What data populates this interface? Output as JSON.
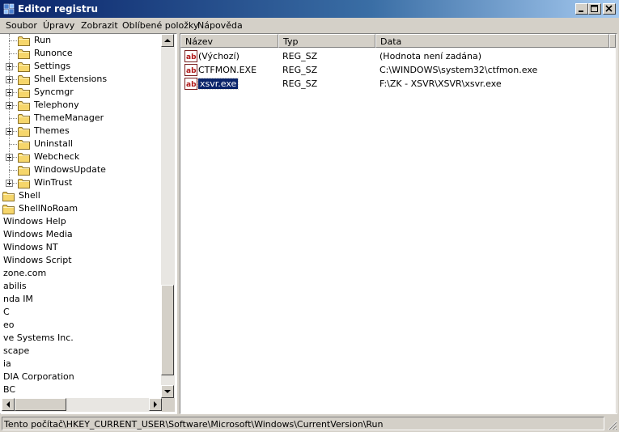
{
  "window": {
    "title": "Editor registru",
    "icon": "regedit-icon"
  },
  "menu": [
    {
      "label": "Soubor"
    },
    {
      "label": "Úpravy"
    },
    {
      "label": "Zobrazit"
    },
    {
      "label": "Oblíbené položky"
    },
    {
      "label": "Nápověda"
    }
  ],
  "tree": {
    "items": [
      {
        "label": "Run",
        "expandable": false
      },
      {
        "label": "Runonce",
        "expandable": false
      },
      {
        "label": "Settings",
        "expandable": true
      },
      {
        "label": "Shell Extensions",
        "expandable": true
      },
      {
        "label": "Syncmgr",
        "expandable": true
      },
      {
        "label": "Telephony",
        "expandable": true
      },
      {
        "label": "ThemeManager",
        "expandable": false
      },
      {
        "label": "Themes",
        "expandable": true
      },
      {
        "label": "Uninstall",
        "expandable": false
      },
      {
        "label": "Webcheck",
        "expandable": true
      },
      {
        "label": "WindowsUpdate",
        "expandable": false
      },
      {
        "label": "WinTrust",
        "expandable": true
      },
      {
        "label": "Shell",
        "expandable": false
      },
      {
        "label": "ShellNoRoam",
        "expandable": false
      },
      {
        "label": "Windows Help"
      },
      {
        "label": "Windows Media"
      },
      {
        "label": "Windows NT"
      },
      {
        "label": "Windows Script"
      },
      {
        "label": "zone.com"
      },
      {
        "label": "abilis"
      },
      {
        "label": "nda IM"
      },
      {
        "label": "C"
      },
      {
        "label": "eo"
      },
      {
        "label": "ve Systems Inc."
      },
      {
        "label": "scape"
      },
      {
        "label": "ia"
      },
      {
        "label": "DIA Corporation"
      },
      {
        "label": "BC"
      }
    ]
  },
  "list": {
    "columns": [
      "Název",
      "Typ",
      "Data"
    ],
    "rows": [
      {
        "name": "(Výchozí)",
        "type": "REG_SZ",
        "data": "(Hodnota není zadána)",
        "selected": false
      },
      {
        "name": "CTFMON.EXE",
        "type": "REG_SZ",
        "data": "C:\\WINDOWS\\system32\\ctfmon.exe",
        "selected": false
      },
      {
        "name": "xsvr.exe",
        "type": "REG_SZ",
        "data": "F:\\ZK - XSVR\\XSVR\\xsvr.exe",
        "selected": true
      }
    ]
  },
  "status": {
    "path": "Tento počítač\\HKEY_CURRENT_USER\\Software\\Microsoft\\Windows\\CurrentVersion\\Run"
  },
  "colors": {
    "titlebar": "#0a246a",
    "selection": "#0a246a",
    "face": "#d4d0c8",
    "folder": "#f6d66b"
  }
}
